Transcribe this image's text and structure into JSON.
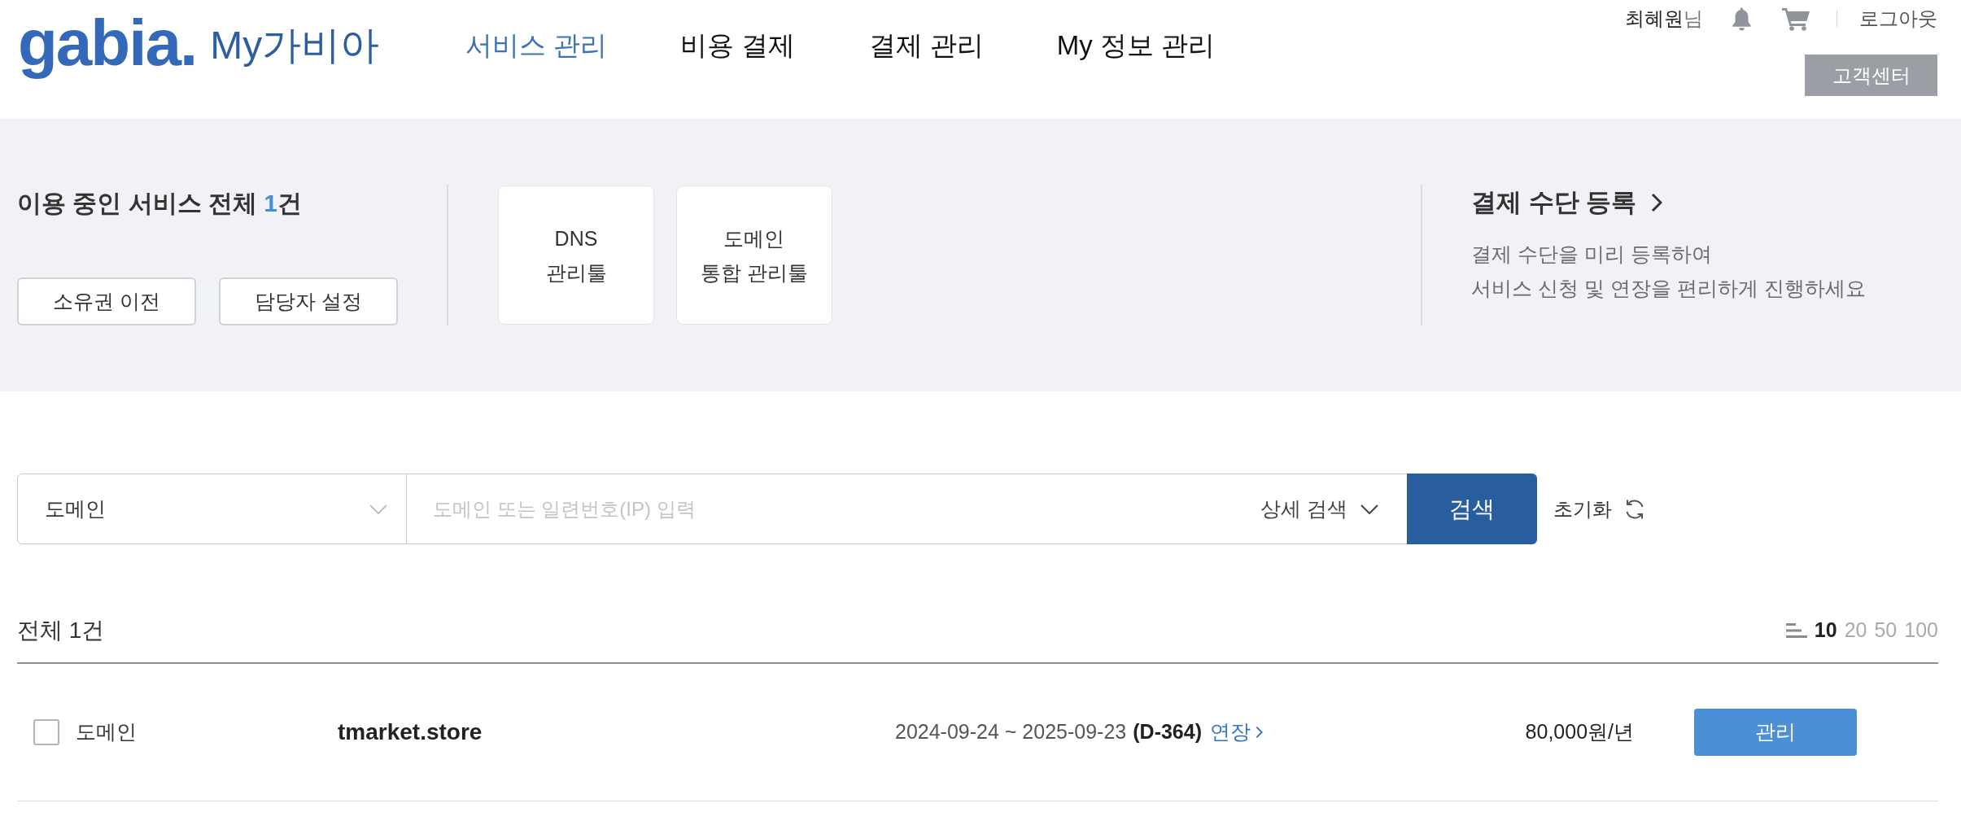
{
  "header": {
    "logo": "gabia.",
    "site_title": "My가비아",
    "nav": [
      {
        "label": "서비스 관리",
        "selected": true
      },
      {
        "label": "비용 결제",
        "selected": false
      },
      {
        "label": "결제 관리",
        "selected": false
      },
      {
        "label": "My 정보 관리",
        "selected": false
      }
    ],
    "user_name": "최혜원",
    "user_suffix": "님",
    "logout": "로그아웃",
    "support_button": "고객센터"
  },
  "summary": {
    "title": "이용 중인 서비스 전체",
    "count": "1",
    "count_unit": "건",
    "actions": [
      "소유권 이전",
      "담당자 설정"
    ],
    "tools": [
      {
        "lines": [
          "DNS",
          "관리툴"
        ]
      },
      {
        "lines": [
          "도메인",
          "통합 관리툴"
        ]
      }
    ],
    "payment": {
      "title": "결제 수단 등록",
      "description_lines": [
        "결제 수단을 미리 등록하여",
        "서비스 신청 및 연장을 편리하게 진행하세요"
      ]
    }
  },
  "search": {
    "type": "도메인",
    "placeholder": "도메인 또는 일련번호(IP) 입력",
    "detail": "상세 검색",
    "button": "검색",
    "reset": "초기화"
  },
  "list": {
    "total": "전체 1건",
    "page_sizes": [
      {
        "label": "10",
        "selected": true
      },
      {
        "label": "20",
        "selected": false
      },
      {
        "label": "50",
        "selected": false
      },
      {
        "label": "100",
        "selected": false
      }
    ],
    "rows": [
      {
        "checked": false,
        "type": "도메인",
        "domain": "tmarket.store",
        "period": "2024-09-24 ~ 2025-09-23",
        "d_day": "(D-364)",
        "renew": "연장",
        "price": "80,000원/년",
        "action": "관리"
      }
    ]
  }
}
